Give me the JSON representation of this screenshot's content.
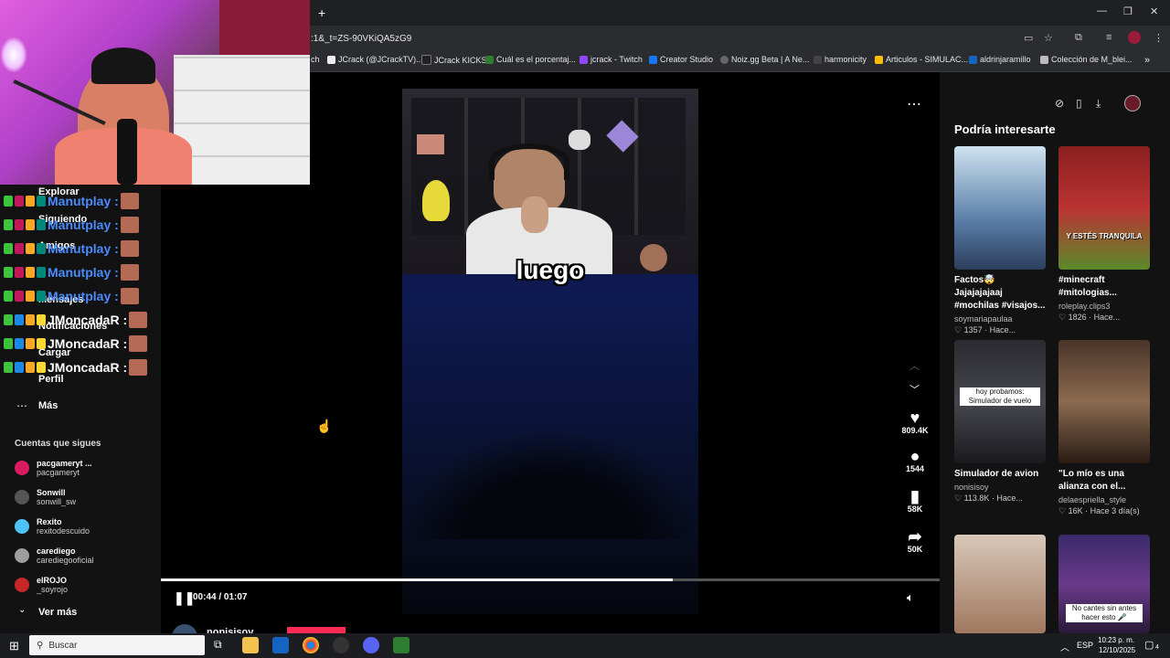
{
  "browser": {
    "url": ":1&_t=ZS-90VKiQA5zG9",
    "new_tab": "+",
    "bookmarks": [
      "ch",
      "JCrack (@JCrackTV)...",
      "JCrack KICKS",
      "Cuál es el porcentaj...",
      "jcrack - Twitch",
      "Creator Studio",
      "Noiz.gg Beta | A Ne...",
      "harmonicity",
      "Articulos - SIMULAC...",
      "aldrinjaramillo",
      "Colección de M_blei..."
    ],
    "bookmarks_more": "»"
  },
  "nav": {
    "items": [
      "Explorar",
      "Siguiendo",
      "Amigos",
      "Mensajes",
      "Notificaciones",
      "Cargar",
      "Perfil"
    ],
    "more": "Más",
    "following_header": "Cuentas que sigues",
    "following": [
      {
        "name": "pacgameryt ...",
        "handle": "pacgameryt",
        "color": "#d81b60"
      },
      {
        "name": "Sonwill",
        "handle": "sonwill_sw",
        "color": "#555"
      },
      {
        "name": "Rexito",
        "handle": "rexitodescuido",
        "color": "#4fc3f7"
      },
      {
        "name": "carediego",
        "handle": "carediegooficial",
        "color": "#9e9e9e"
      },
      {
        "name": "elROJO",
        "handle": "_soyrojo",
        "color": "#c62828"
      }
    ],
    "see_more": "Ver más"
  },
  "chat": [
    {
      "user": "Manutplay :",
      "color": "#4a8cff"
    },
    {
      "user": "Manutplay :",
      "color": "#4a8cff"
    },
    {
      "user": "Manutplay :",
      "color": "#4a8cff"
    },
    {
      "user": "Manutplay :",
      "color": "#4a8cff"
    },
    {
      "user": "Manutplay :",
      "color": "#4a8cff"
    },
    {
      "user": "JMoncadaR :",
      "color": "#ffffff"
    },
    {
      "user": "JMoncadaR :",
      "color": "#ffffff"
    },
    {
      "user": "JMoncadaR :",
      "color": "#ffffff"
    }
  ],
  "video": {
    "caption": "luego",
    "likes": "809.4K",
    "comments": "1544",
    "saves": "58K",
    "shares": "50K",
    "time": "00:44 / 01:07",
    "progress": 0.657,
    "author_partial": "nonisisoy"
  },
  "right": {
    "header": "Podría interesarte",
    "cards": [
      {
        "title": "Factos🤯 Jajajajajaaj\n#mochilas #visajos...",
        "user": "soymariapaulaa",
        "stats": "♡ 1357 · Hace...",
        "thumb_text": "",
        "bg": "linear-gradient(#cfe3f0,#5a7ea8 60%,#2c3e5c)"
      },
      {
        "title": "#minecraft\n#mitologias...",
        "user": "roleplay.clips3",
        "stats": "♡ 1826 · Hace...",
        "thumb_text": "Y ESTÉS TRANQUILA",
        "bg": "linear-gradient(#8a1f1f,#b33,#5a8a2a)"
      },
      {
        "title": "Simulador de avion",
        "user": "nonisisoy",
        "stats": "♡ 113.8K · Hace...",
        "thumb_text": "hoy probamos:\nSimulador de vuelo",
        "bg": "linear-gradient(#2a2a30,#46464e 50%,#1a1a1e)"
      },
      {
        "title": "\"Lo mío es una\nalianza con el...",
        "user": "delaespriella_style",
        "stats": "♡ 16K · Hace 3 día(s)",
        "thumb_text": "",
        "bg": "linear-gradient(#4a3428,#8a6a50 50%,#2a1c14)"
      },
      {
        "title": "",
        "user": "",
        "stats": "",
        "thumb_text": "",
        "bg": "linear-gradient(#d8c8b8,#a07860)"
      },
      {
        "title": "",
        "user": "",
        "stats": "",
        "thumb_text": "No cantes sin antes\nhacer esto 🎤",
        "bg": "linear-gradient(#3a2a6a,#6a3a8a 50%,#2a1a3a)"
      }
    ]
  },
  "taskbar": {
    "search": "Buscar",
    "lang": "ESP",
    "time": "10:23 p. m.",
    "date": "12/10/2025",
    "notif": "4"
  }
}
